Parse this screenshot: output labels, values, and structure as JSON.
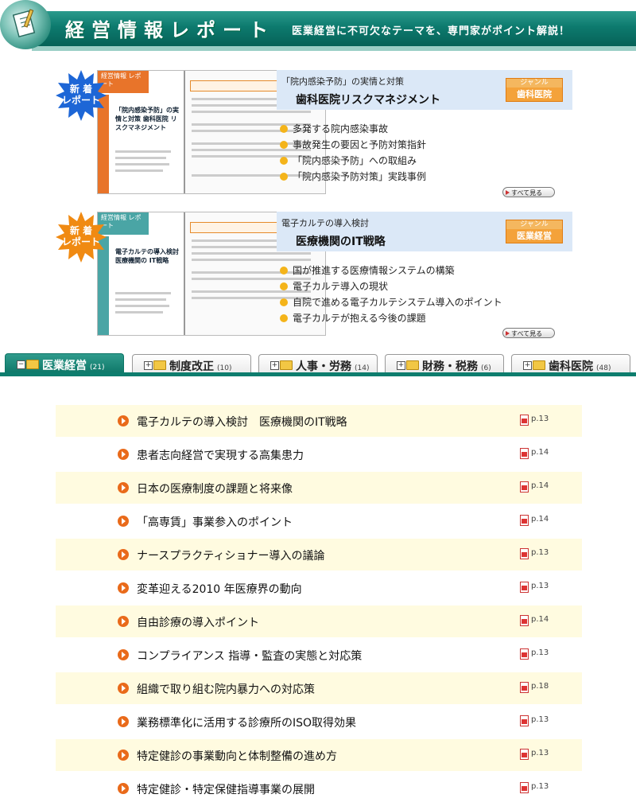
{
  "header": {
    "title": "経営情報レポート",
    "subtitle": "医業経営に不可欠なテーマを、専門家がポイント解説！"
  },
  "features": [
    {
      "badge": [
        "新 着",
        "レポート"
      ],
      "cover": {
        "tag": "経営情報 レポート",
        "title": "「院内感染予防」の実情と対策 歯科医院 リスクマネジメント",
        "accent": "#e8742a"
      },
      "pre_title": "「院内感染予防」の実情と対策",
      "title": "歯科医院リスクマネジメント",
      "genre_label": "ジャンル",
      "genre": "歯科医院",
      "bullets": [
        "多発する院内感染事故",
        "事故発生の要因と予防対策指針",
        "「院内感染予防」への取組み",
        "「院内感染予防対策」実践事例"
      ],
      "more_label": "すべて見る"
    },
    {
      "badge": [
        "新 着",
        "レポート"
      ],
      "cover": {
        "tag": "経営情報 レポート",
        "title": "電子カルテの導入検討 医療機関の IT戦略",
        "accent": "#4aa5a5"
      },
      "pre_title": "電子カルテの導入検討",
      "title": "医療機関のIT戦略",
      "genre_label": "ジャンル",
      "genre": "医業経営",
      "bullets": [
        "国が推進する医療情報システムの構築",
        "電子カルテ導入の現状",
        "自院で進める電子カルテシステム導入のポイント",
        "電子カルテが抱える今後の課題"
      ],
      "more_label": "すべて見る"
    }
  ],
  "tabs": [
    {
      "label": "医業経営",
      "count": "(21)",
      "active": true,
      "sign": "−"
    },
    {
      "label": "制度改正",
      "count": "(10)",
      "active": false,
      "sign": "+"
    },
    {
      "label": "人事・労務",
      "count": "(14)",
      "active": false,
      "sign": "+"
    },
    {
      "label": "財務・税務",
      "count": "(6)",
      "active": false,
      "sign": "+"
    },
    {
      "label": "歯科医院",
      "count": "(48)",
      "active": false,
      "sign": "+"
    }
  ],
  "reports": [
    {
      "title": "電子カルテの導入検討　医療機関のIT戦略",
      "page": "p.13"
    },
    {
      "title": "患者志向経営で実現する高集患力",
      "page": "p.14"
    },
    {
      "title": "日本の医療制度の課題と将来像",
      "page": "p.14"
    },
    {
      "title": "「高専賃」事業参入のポイント",
      "page": "p.14"
    },
    {
      "title": "ナースプラクティショナー導入の議論",
      "page": "p.13"
    },
    {
      "title": "変革迎える2010 年医療界の動向",
      "page": "p.13"
    },
    {
      "title": "自由診療の導入ポイント",
      "page": "p.14"
    },
    {
      "title": "コンプライアンス 指導・監査の実態と対応策",
      "page": "p.13"
    },
    {
      "title": "組織で取り組む院内暴力への対応策",
      "page": "p.18"
    },
    {
      "title": "業務標準化に活用する診療所のISO取得効果",
      "page": "p.13"
    },
    {
      "title": "特定健診の事業動向と体制整備の進め方",
      "page": "p.13"
    },
    {
      "title": "特定健診・特定保健指導事業の展開",
      "page": "p.13"
    }
  ],
  "colors": {
    "brand": "#0d7a6e",
    "row_highlight": "#fffbe0",
    "genre": "#f4a23a",
    "info_box": "#dbe8f7"
  }
}
